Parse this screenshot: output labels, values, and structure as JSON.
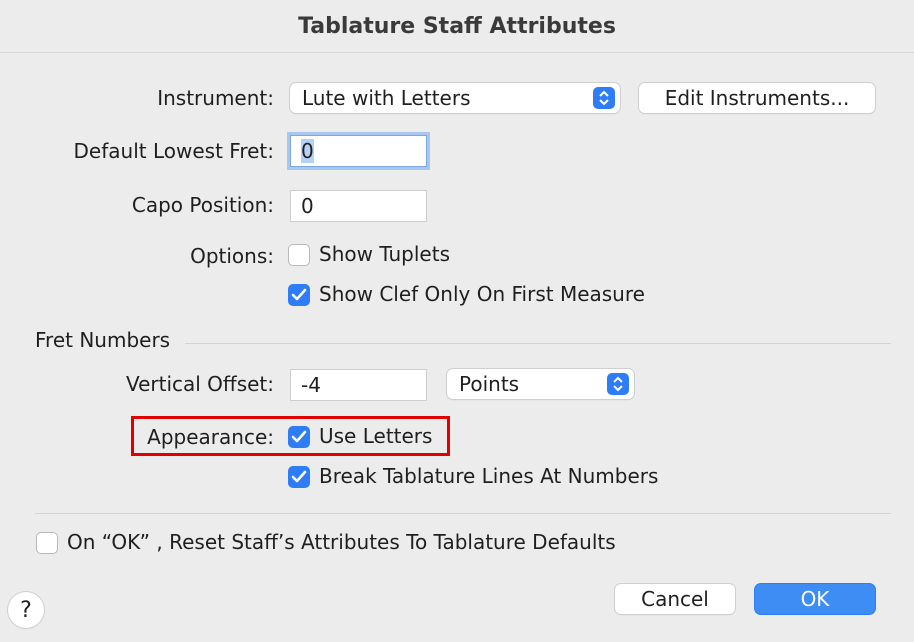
{
  "dialog": {
    "title": "Tablature Staff Attributes"
  },
  "instrument": {
    "label": "Instrument:",
    "value": "Lute with Letters",
    "edit_button": "Edit Instruments..."
  },
  "lowest_fret": {
    "label": "Default Lowest Fret:",
    "value": "0"
  },
  "capo": {
    "label": "Capo Position:",
    "value": "0"
  },
  "options": {
    "label": "Options:",
    "show_tuplets": {
      "label": "Show Tuplets",
      "checked": false
    },
    "show_clef": {
      "label": "Show Clef Only On First Measure",
      "checked": true
    }
  },
  "fret_numbers": {
    "section_label": "Fret Numbers",
    "offset_label": "Vertical Offset:",
    "offset_value": "-4",
    "units": "Points",
    "appearance_label": "Appearance:",
    "use_letters": {
      "label": "Use Letters",
      "checked": true
    },
    "break_lines": {
      "label": "Break Tablature Lines At Numbers",
      "checked": true
    }
  },
  "reset": {
    "label": "On “OK” , Reset Staff’s Attributes To Tablature Defaults",
    "checked": false
  },
  "buttons": {
    "cancel": "Cancel",
    "ok": "OK",
    "help": "?"
  },
  "colors": {
    "accent": "#2e7cf6",
    "highlight": "#e00000"
  }
}
